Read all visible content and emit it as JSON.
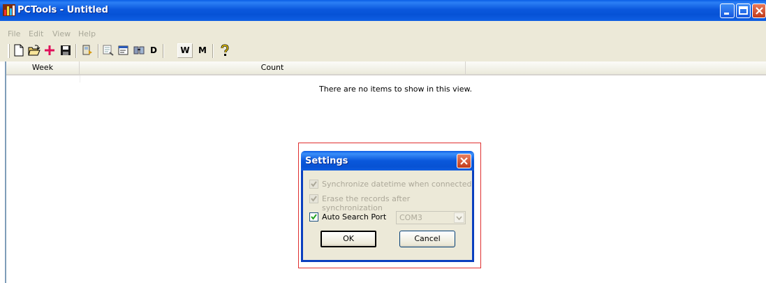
{
  "window": {
    "title": "PCTools - Untitled",
    "accent": "#0a58dc"
  },
  "menu": {
    "items": [
      "File",
      "Edit",
      "View",
      "Help"
    ]
  },
  "toolbar": {
    "icons": [
      "new-document-icon",
      "open-folder-icon",
      "add-plus-icon",
      "save-disk-icon",
      "device-icon",
      "records-icon",
      "properties-icon",
      "transfer-icon",
      "help-icon"
    ],
    "d_label": "D",
    "w_label": "W",
    "m_label": "M"
  },
  "list": {
    "columns": [
      "Week",
      "Count"
    ],
    "empty_message": "There are no items to show in this view."
  },
  "dialog": {
    "title": "Settings",
    "sync_datetime_label": "Synchronize datetime when connected",
    "sync_datetime_checked": true,
    "erase_records_label": "Erase the records after synchronization",
    "erase_records_checked": true,
    "auto_search_label": "Auto Search Port",
    "auto_search_checked": true,
    "port_value": "COM3",
    "ok_label": "OK",
    "cancel_label": "Cancel"
  }
}
